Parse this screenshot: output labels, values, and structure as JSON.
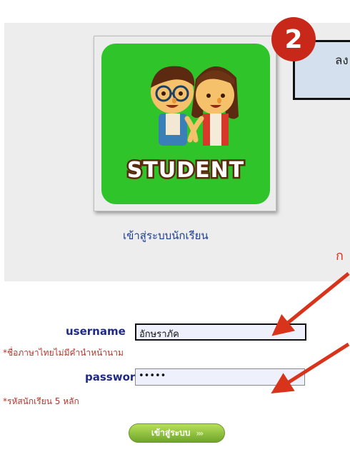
{
  "logo": {
    "word": "STUDENT"
  },
  "caption": "เข้าสู่ระบบนักเรียน",
  "callout": {
    "number": "2",
    "text": "ลง"
  },
  "side_note": "ก",
  "username": {
    "label": "username",
    "value": "อักษราภัค",
    "hint": "*ชื่อภาษาไทยไม่มีคำนำหน้านาม"
  },
  "password": {
    "label": "password",
    "value": "•••••",
    "hint": "*รหัสนักเรียน 5 หลัก"
  },
  "login_button": {
    "label": "เข้าสู่ระบบ",
    "chevrons": "›››"
  },
  "colors": {
    "accent_red": "#d8331b",
    "label_blue": "#1f2a86",
    "logo_green": "#2ec42a"
  }
}
